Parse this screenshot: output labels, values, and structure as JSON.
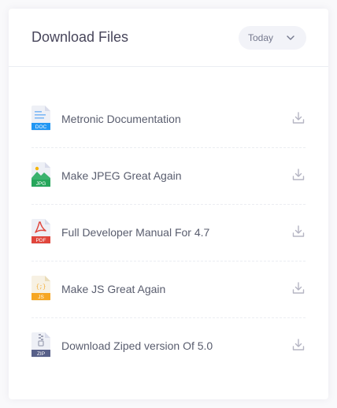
{
  "header": {
    "title": "Download Files",
    "filter_label": "Today"
  },
  "files": [
    {
      "name": "Metronic Documentation",
      "type": "DOC",
      "icon": "doc-file-icon",
      "color": "#2196f3"
    },
    {
      "name": "Make JPEG Great Again",
      "type": "JPG",
      "icon": "jpg-file-icon",
      "color": "#26a65b"
    },
    {
      "name": "Full Developer Manual For 4.7",
      "type": "PDF",
      "icon": "pdf-file-icon",
      "color": "#e0463c"
    },
    {
      "name": "Make JS Great Again",
      "type": "JS",
      "icon": "js-file-icon",
      "color": "#f6a623"
    },
    {
      "name": "Download Ziped version Of 5.0",
      "type": "ZIP",
      "icon": "zip-file-icon",
      "color": "#586089"
    }
  ]
}
